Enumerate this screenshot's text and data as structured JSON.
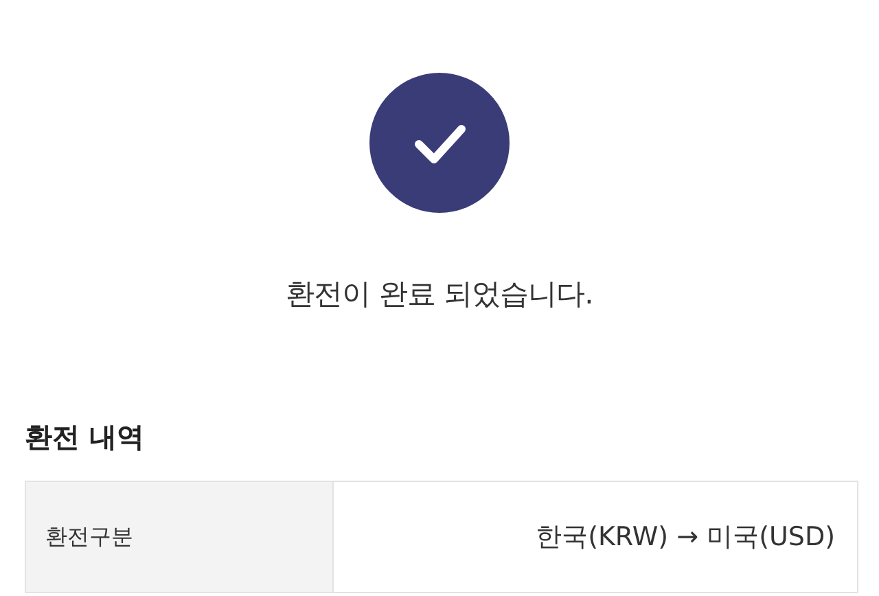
{
  "message": "환전이 완료 되었습니다.",
  "section_title": "환전 내역",
  "rows": [
    {
      "label": "환전구분",
      "value": "한국(KRW) → 미국(USD)"
    }
  ]
}
